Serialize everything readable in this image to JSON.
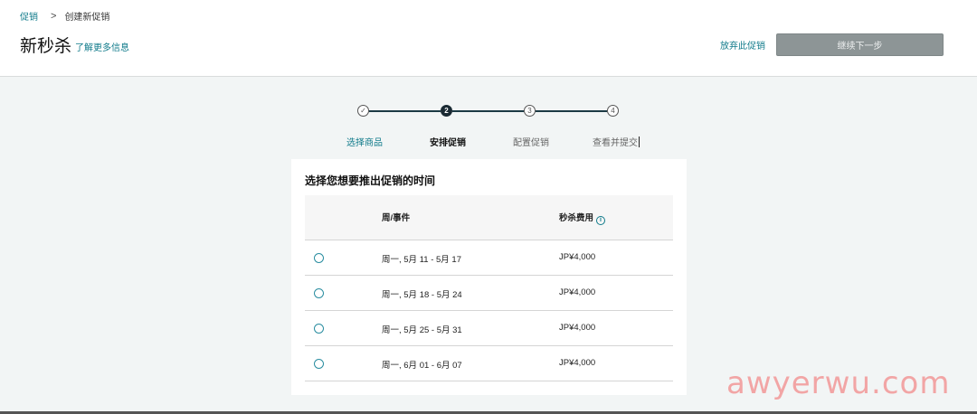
{
  "breadcrumb": {
    "parent": "促销",
    "separator": ">",
    "current": "创建新促销"
  },
  "header": {
    "title": "新秒杀",
    "learn_more": "了解更多信息",
    "abandon": "放弃此促销",
    "continue": "继续下一步"
  },
  "steps": [
    {
      "marker": "✓",
      "label": "选择商品",
      "state": "done"
    },
    {
      "marker": "2",
      "label": "安排促销",
      "state": "active"
    },
    {
      "marker": "3",
      "label": "配置促销",
      "state": "pending"
    },
    {
      "marker": "4",
      "label": "查看并提交",
      "state": "pending"
    }
  ],
  "card": {
    "title": "选择您想要推出促销的时间",
    "columns": {
      "week": "周/事件",
      "fee": "秒杀费用",
      "info_icon": "i"
    },
    "rows": [
      {
        "week": "周一, 5月 11 - 5月 17",
        "fee": "JP¥4,000",
        "selected": false
      },
      {
        "week": "周一, 5月 18 - 5月 24",
        "fee": "JP¥4,000",
        "selected": false
      },
      {
        "week": "周一, 5月 25 - 5月 31",
        "fee": "JP¥4,000",
        "selected": false
      },
      {
        "week": "周一, 6月 01 - 6月 07",
        "fee": "JP¥4,000",
        "selected": false
      }
    ]
  },
  "watermark": "awyerwu.com",
  "colors": {
    "link": "#0f7a8a",
    "stepper": "#1c3a44",
    "button_disabled": "#8d9596",
    "watermark": "#f2a5a5"
  }
}
